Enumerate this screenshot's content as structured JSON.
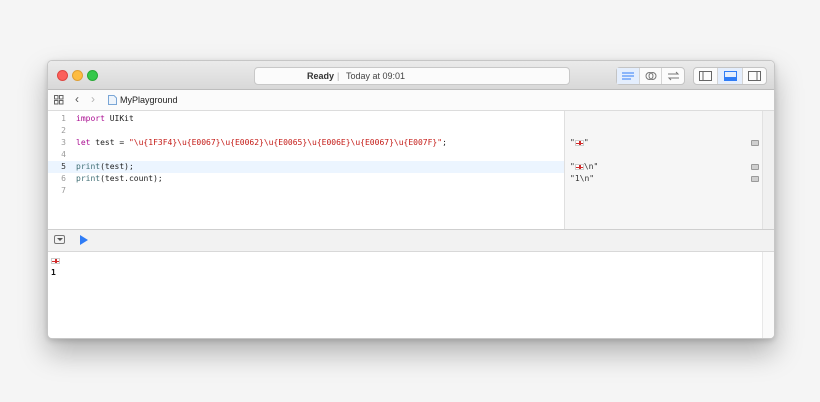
{
  "window": {
    "status": {
      "state": "Ready",
      "separator": "|",
      "time": "Today at 09:01"
    }
  },
  "navbar": {
    "filename": "MyPlayground"
  },
  "editor": {
    "lines": [
      {
        "num": "1",
        "kw": "import",
        "rest": " UIKit"
      },
      {
        "num": "2"
      },
      {
        "num": "3",
        "kw": "let",
        "rest": " test = ",
        "str": "\"\\u{1F3F4}\\u{E0067}\\u{E0062}\\u{E0065}\\u{E006E}\\u{E0067}\\u{E007F}\"",
        "tail": ";"
      },
      {
        "num": "4"
      },
      {
        "num": "5",
        "fn": "print",
        "rest": "(test);"
      },
      {
        "num": "6",
        "fn": "print",
        "rest": "(test.count);"
      },
      {
        "num": "7"
      }
    ],
    "results": [
      {
        "line": "3",
        "pre": "\"",
        "post": "\""
      },
      {
        "line": "5",
        "pre": "\"",
        "post": "\\n\""
      },
      {
        "line": "6",
        "text": "\"1\\n\""
      }
    ]
  },
  "console": {
    "lines": [
      "",
      "1"
    ]
  },
  "icons": {
    "status_left": "editor-standard-icon",
    "assistant": "assistant-editor-icon",
    "version": "version-editor-icon",
    "navigator": "navigator-toggle-icon",
    "debug": "debug-area-toggle-icon",
    "utilities": "utilities-toggle-icon"
  },
  "colors": {
    "accent": "#2f7cf6",
    "keyword": "#aa0d91",
    "string": "#c41a16"
  }
}
